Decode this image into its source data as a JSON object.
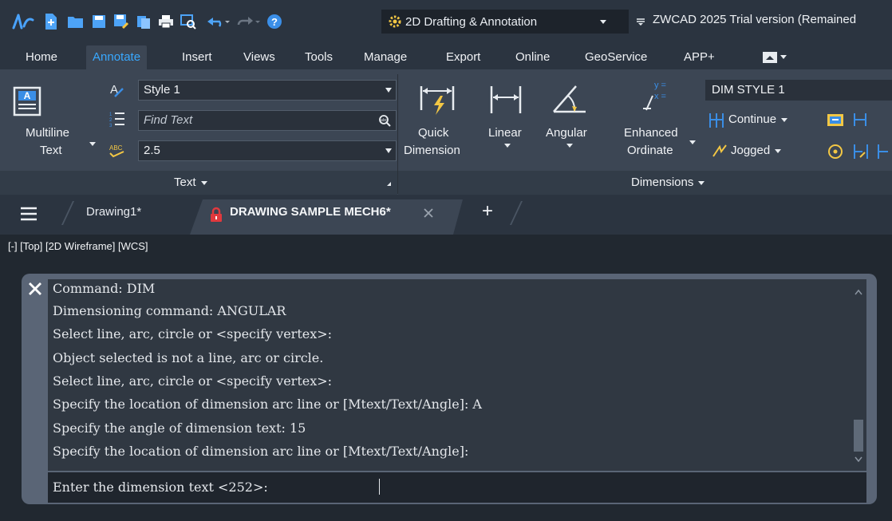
{
  "titlebar": {
    "workspace": "2D Drafting & Annotation",
    "title": "ZWCAD 2025 Trial version (Remained"
  },
  "menu": {
    "items": [
      "Home",
      "Annotate",
      "Insert",
      "Views",
      "Tools",
      "Manage",
      "Export",
      "Online",
      "GeoService",
      "APP+"
    ],
    "active": "Annotate"
  },
  "ribbon": {
    "text_panel": {
      "multiline_text": [
        "Multiline",
        "Text"
      ],
      "style_value": "Style 1",
      "find_placeholder": "Find Text",
      "height_value": "2.5",
      "panel_label": "Text"
    },
    "dimensions_panel": {
      "quick_dimension": [
        "Quick",
        "Dimension"
      ],
      "linear": "Linear",
      "angular": "Angular",
      "enhanced_ordinate": [
        "Enhanced",
        "Ordinate"
      ],
      "dim_style": "DIM STYLE 1",
      "continue": "Continue",
      "jogged": "Jogged",
      "panel_label": "Dimensions"
    }
  },
  "tabs": {
    "items": [
      {
        "label": "Drawing1*"
      },
      {
        "label": "DRAWING SAMPLE MECH6*"
      }
    ],
    "add_label": "+"
  },
  "viewport_label": "[-] [Top] [2D Wireframe] [WCS]",
  "command": {
    "lines": [
      "Command: DIM",
      "Dimensioning command: ANGULAR",
      "Select line, arc, circle or <specify vertex>:",
      "Object selected is not a line, arc or circle.",
      "Select line, arc, circle or <specify vertex>:",
      "Specify the location of dimension arc line or [Mtext/Text/Angle]: A",
      "Specify the angle of dimension text: 15",
      "Specify the location of dimension arc line or [Mtext/Text/Angle]:"
    ],
    "prompt": "Enter the dimension text <252>: "
  },
  "colors": {
    "accent": "#38a8ff",
    "ribbon_bg": "#3c4654",
    "titlebar_bg": "#2b3440",
    "command_bg": "#303842",
    "lock_red": "#e0393e"
  }
}
